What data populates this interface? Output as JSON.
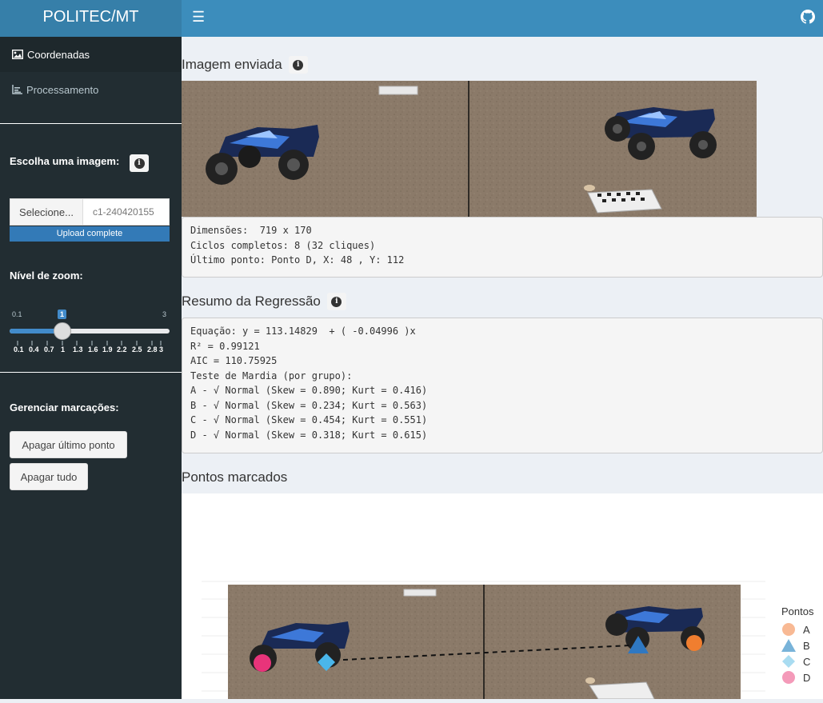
{
  "header": {
    "logo_text": "POLITEC/MT",
    "menu_icon": "hamburger-icon",
    "github_icon": "github-icon",
    "brand_color": "#3c8dbc"
  },
  "sidebar": {
    "menu": [
      {
        "label": "Coordenadas",
        "icon": "image-icon",
        "active": true
      },
      {
        "label": "Processamento",
        "icon": "chart-icon",
        "active": false
      }
    ],
    "image_label": "Escolha uma imagem:",
    "file_button": "Selecione...",
    "file_name": "c1-240420155",
    "upload_status": "Upload complete",
    "upload_progress": 1.0,
    "zoom_label": "Nível de zoom:",
    "zoom": {
      "min": "0.1",
      "max": "3",
      "value": "1",
      "grid": [
        "0.1",
        "0.4",
        "0.7",
        "1",
        "1.3",
        "1.6",
        "1.9",
        "2.2",
        "2.5",
        "2.8",
        "3"
      ]
    },
    "manage_label": "Gerenciar marcações:",
    "undo_button": "Apagar último ponto",
    "clear_button": "Apagar tudo"
  },
  "main": {
    "image_section": {
      "title": "Imagem enviada",
      "lines": [
        "Dimensões:  719 x 170",
        "Ciclos completos: 8 (32 cliques)",
        "Último ponto: Ponto D, X: 48 , Y: 112"
      ]
    },
    "regression_section": {
      "title": "Resumo da Regressão",
      "lines": [
        "Equação: y = 113.14829  + ( -0.04996 )x",
        "R² = 0.99121",
        "AIC = 110.75925",
        "Teste de Mardia (por grupo):",
        "A - √ Normal (Skew = 0.890; Kurt = 0.416)",
        "B - √ Normal (Skew = 0.234; Kurt = 0.563)",
        "C - √ Normal (Skew = 0.454; Kurt = 0.551)",
        "D - √ Normal (Skew = 0.318; Kurt = 0.615)"
      ]
    },
    "points_section": {
      "title": "Pontos marcados",
      "legend_title": "Pontos",
      "legend": [
        {
          "label": "A",
          "shape": "circle",
          "color": "#f8b994"
        },
        {
          "label": "B",
          "shape": "triangle",
          "color": "#78b3d9"
        },
        {
          "label": "C",
          "shape": "diamond",
          "color": "#a9dcf1"
        },
        {
          "label": "D",
          "shape": "circle",
          "color": "#f49ab9"
        }
      ]
    }
  }
}
